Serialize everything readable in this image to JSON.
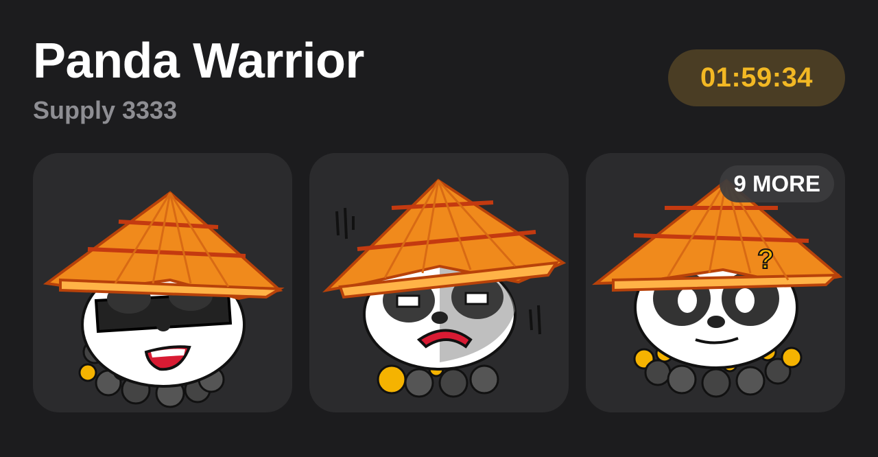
{
  "collection": {
    "name": "Panda Warrior",
    "supply_label": "Supply 3333",
    "countdown": "01:59:34"
  },
  "gallery": {
    "items": [
      {
        "variant": "sunglasses",
        "icon": "panda-sunglasses-icon"
      },
      {
        "variant": "grumpy",
        "icon": "panda-grumpy-icon"
      },
      {
        "variant": "confused",
        "icon": "panda-confused-icon"
      }
    ],
    "more_label": "9 MORE"
  },
  "colors": {
    "background": "#1c1c1e",
    "card": "#2b2b2d",
    "accent": "#f2b824",
    "hat": "#f08a1c"
  }
}
